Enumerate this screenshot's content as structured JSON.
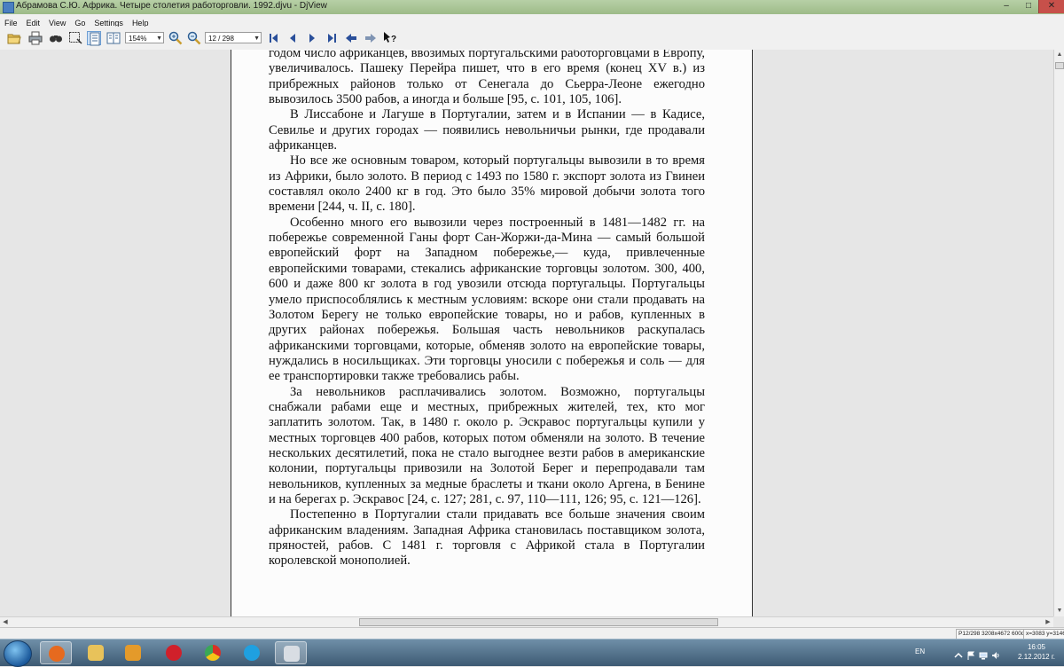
{
  "window": {
    "title": "Абрамова С.Ю. Африка. Четыре столетия работорговли. 1992.djvu - DjView",
    "controls": {
      "minimize": "–",
      "maximize": "□",
      "close": "✕"
    }
  },
  "menu": [
    "File",
    "Edit",
    "View",
    "Go",
    "Settings",
    "Help"
  ],
  "toolbar": {
    "zoom_value": "154%",
    "page_value": "12 / 298",
    "icons": [
      "open-icon",
      "print-icon",
      "find-icon",
      "select-icon",
      "continuous-icon",
      "side-by-side-icon",
      "zoom-in-icon",
      "zoom-out-icon",
      "first-page-icon",
      "previous-page-icon",
      "next-page-icon",
      "last-page-icon",
      "back-icon",
      "forward-icon",
      "whats-this-icon"
    ]
  },
  "document": {
    "paragraphs": [
      {
        "indent": false,
        "text": "годом число африканцев, ввозимых португальскими работорговцами в Европу, увеличивалось. Пашеку Перейра пишет, что в его время (конец XV в.) из прибрежных районов только от Сенегала до Сьерра-Леоне ежегодно вывозилось 3500 рабов, а иногда и больше [95, с. 101, 105, 106]."
      },
      {
        "indent": true,
        "text": "В Лиссабоне и Лагуше в Португалии, затем и в Испании — в Кадисе, Севилье и других городах — появились невольничьи рынки, где продавали африканцев."
      },
      {
        "indent": true,
        "text": "Но все же основным товаром, который португальцы вывозили в то время из Африки, было золото. В период с 1493 по 1580 г. экспорт золота из Гвинеи составлял около 2400 кг в год. Это было 35% мировой добычи золота того времени [244, ч. II, с. 180]."
      },
      {
        "indent": true,
        "text": "Особенно много его вывозили через построенный в 1481—1482 гг. на побережье современной Ганы форт Сан-Жоржи-да-Мина — самый большой европейский форт на Западном побережье,— куда, привлеченные европейскими товарами, стекались африканские торговцы золотом. 300, 400, 600 и даже 800 кг золота в год увозили отсюда португальцы. Португальцы умело приспособлялись к местным условиям: вскоре они стали продавать на Золотом Берегу не только европейские товары, но и рабов, купленных в других районах побережья. Большая часть невольников раскупалась африканскими торговцами, которые, обменяв золото на европейские товары, нуждались в носильщиках. Эти торговцы уносили с побережья и соль — для ее транспортировки также требовались рабы."
      },
      {
        "indent": true,
        "text": "За невольников расплачивались золотом. Возможно, португальцы снабжали рабами еще и местных, прибрежных жителей, тех, кто мог заплатить золотом. Так, в 1480 г. около р. Эскравос португальцы купили у местных торговцев 400 рабов, которых потом обменяли на золото. В течение нескольких десятилетий, пока не стало выгоднее везти рабов в американские колонии, португальцы привозили на Золотой Берег и перепродавали там невольников, купленных за медные браслеты и ткани около Аргена, в Бенине и на берегах р. Эскравос [24, с. 127; 281, с. 97, 110—111, 126; 95, с. 121—126]."
      },
      {
        "indent": true,
        "text": "Постепенно в Португалии стали придавать все больше значения своим африканским владениям. Западная Африка становилась поставщиком золота, пряностей, рабов. С 1481 г. торговля с Африкой стала в Португалии королевской монополией."
      }
    ]
  },
  "status": {
    "page_info": "P12/298 3208x4672 600dpi",
    "coords": "x=3083 y=3146"
  },
  "taskbar": {
    "apps": [
      {
        "name": "explorer-icon",
        "color": "#e8c25a",
        "active": false
      },
      {
        "name": "media-player-icon",
        "color": "#e49a2a",
        "active": false
      },
      {
        "name": "opera-icon",
        "color": "#d0202a",
        "active": false
      },
      {
        "name": "chrome-icon",
        "color": "#3aa757",
        "active": false
      },
      {
        "name": "skype-icon",
        "color": "#1fa0e0",
        "active": false
      },
      {
        "name": "djview-icon",
        "color": "#d8dde3",
        "active": true
      }
    ],
    "first_app": {
      "name": "firefox-icon",
      "color": "#e66a1f",
      "active": true
    },
    "lang": "EN",
    "time": "16:05",
    "date": "2.12.2012 г."
  }
}
